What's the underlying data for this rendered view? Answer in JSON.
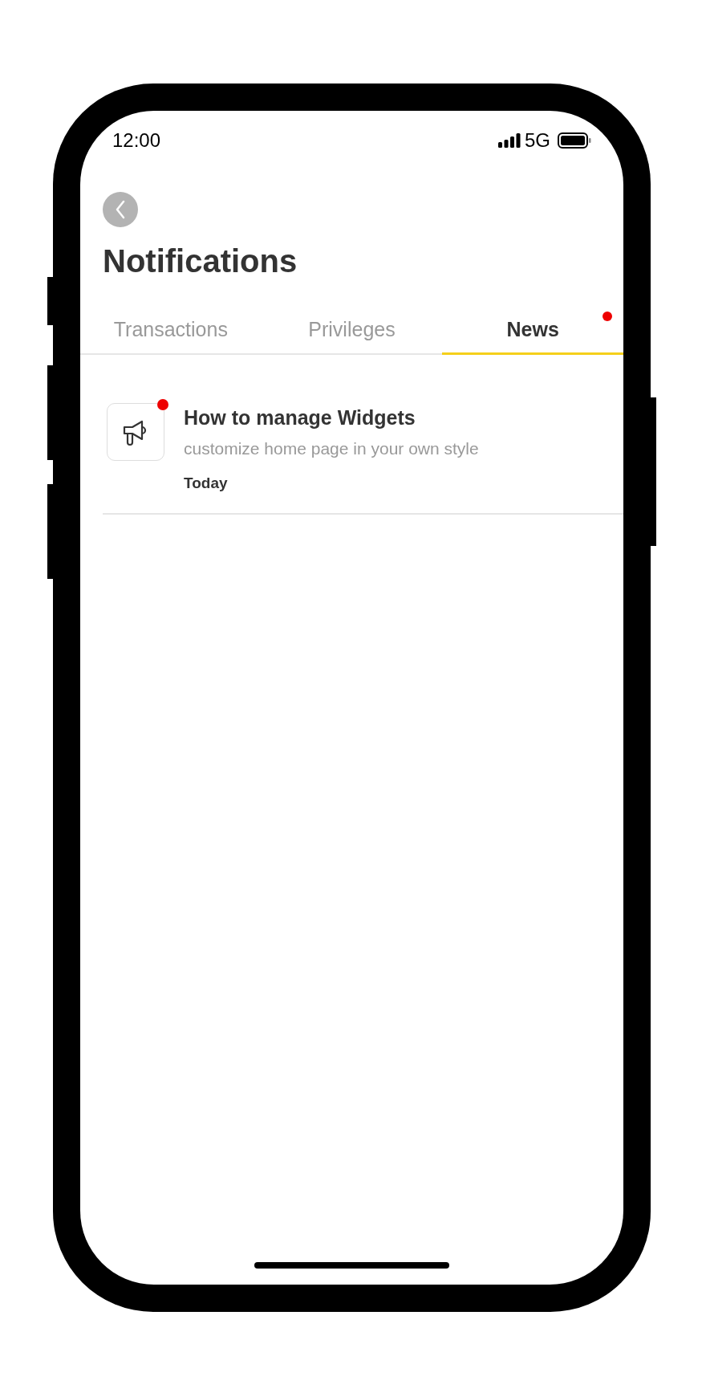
{
  "status_bar": {
    "time": "12:00",
    "network": "5G"
  },
  "header": {
    "title": "Notifications"
  },
  "tabs": [
    {
      "label": "Transactions",
      "selected": false,
      "unread": false
    },
    {
      "label": "Privileges",
      "selected": false,
      "unread": false
    },
    {
      "label": "News",
      "selected": true,
      "unread": true
    }
  ],
  "notifications": [
    {
      "title": "How to manage Widgets",
      "body": "customize home page in your own style",
      "date": "Today",
      "unread": true
    }
  ]
}
